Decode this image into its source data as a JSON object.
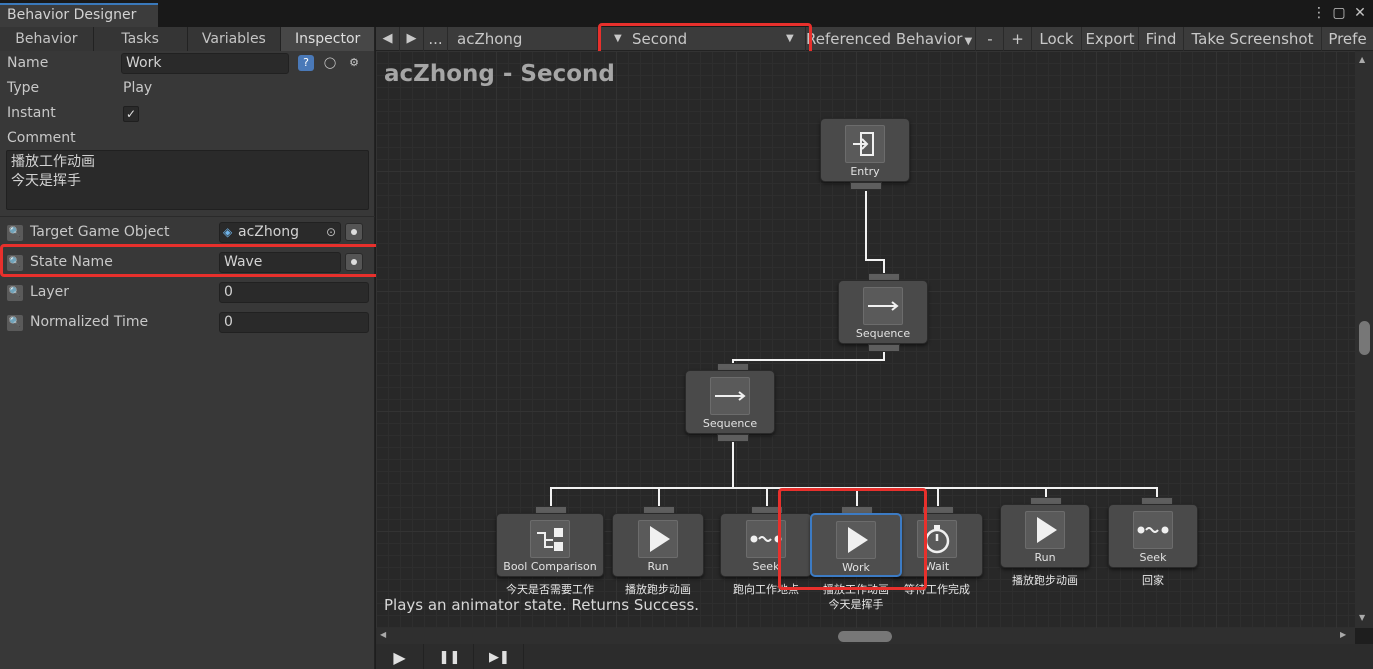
{
  "window": {
    "title": "Behavior Designer",
    "menu_icon": "kebab-menu-icon",
    "maximize_icon": "maximize-icon",
    "close_icon": "close-icon"
  },
  "left_tabs": [
    "Behavior",
    "Tasks",
    "Variables",
    "Inspector"
  ],
  "inspector": {
    "name_label": "Name",
    "name_value": "Work",
    "type_label": "Type",
    "type_value": "Play",
    "instant_label": "Instant",
    "instant_checked": "✓",
    "comment_label": "Comment",
    "comment_value": "播放工作动画\n今天是挥手",
    "fields": [
      {
        "label": "Target Game Object",
        "value": "acZhong"
      },
      {
        "label": "State Name",
        "value": "Wave"
      },
      {
        "label": "Layer",
        "value": "0"
      },
      {
        "label": "Normalized Time",
        "value": "0"
      }
    ]
  },
  "toolbar": {
    "prev": "◀",
    "next": "▶",
    "more": "...",
    "behavior_name": "acZhong",
    "dropdown_value": "Second",
    "referenced": "Referenced Behavior",
    "minus": "-",
    "plus": "+",
    "lock": "Lock",
    "export": "Export",
    "find": "Find",
    "screenshot": "Take Screenshot",
    "prefs": "Prefe"
  },
  "graph": {
    "title": "acZhong - Second",
    "tooltip": "Plays an animator state. Returns Success.",
    "nodes": {
      "entry": {
        "label": "Entry"
      },
      "seq1": {
        "label": "Sequence"
      },
      "seq2": {
        "label": "Sequence"
      },
      "bool": {
        "label": "Bool Comparison",
        "comment": "今天是否需要工作"
      },
      "run1": {
        "label": "Run",
        "comment": "播放跑步动画"
      },
      "seek1": {
        "label": "Seek",
        "comment": "跑向工作地点"
      },
      "work": {
        "label": "Work",
        "comment": "播放工作动画\n今天是挥手"
      },
      "wait": {
        "label": "Wait",
        "comment": "等待工作完成"
      },
      "run2": {
        "label": "Run",
        "comment": "播放跑步动画"
      },
      "seek2": {
        "label": "Seek",
        "comment": "回家"
      }
    }
  },
  "playbar": {
    "play": "▶",
    "pause": "❚❚",
    "step": "▶❚"
  },
  "colors": {
    "highlight": "#e8302c",
    "selected": "#3c7bc4",
    "accent": "#3a79bb"
  }
}
